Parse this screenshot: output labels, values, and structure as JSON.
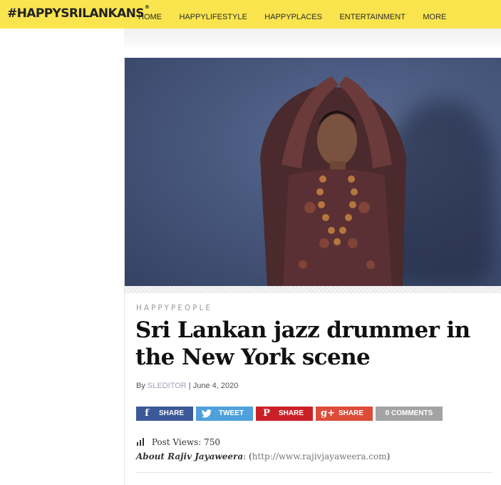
{
  "site": {
    "logo": "#HAPPYSRILANKANS",
    "logo_mark": "®"
  },
  "nav": {
    "items": [
      "HOME",
      "HAPPYLIFESTYLE",
      "HAPPYPLACES",
      "ENTERTAINMENT",
      "MORE"
    ]
  },
  "article": {
    "category": "HAPPYPEOPLE",
    "title": "Sri Lankan jazz drummer in the New York scene",
    "by_prefix": "By",
    "author": "SLEDITOR",
    "separator": "|",
    "date": "June 4, 2020",
    "post_views_label": "Post Views:",
    "post_views_value": "750",
    "about_name": "About Rajiv Jayaweera",
    "about_colon": ":",
    "about_url_open": "(",
    "about_url": "http://www.rajivjayaweera.com",
    "about_url_close": ")"
  },
  "share": {
    "facebook": {
      "icon": "f",
      "label": "SHARE",
      "color": "#3b5998"
    },
    "twitter": {
      "icon": "bird-icon",
      "label": "TWEET",
      "color": "#4fa0db"
    },
    "pinterest": {
      "icon": "P",
      "label": "SHARE",
      "color": "#cb2027"
    },
    "googleplus": {
      "icon": "g+",
      "label": "SHARE",
      "color": "#dd4b39"
    },
    "comments": {
      "label": "0 COMMENTS",
      "color": "#a3a3a3"
    }
  },
  "colors": {
    "topbar": "#fae54f",
    "hero_bg": "#4a5a80"
  }
}
